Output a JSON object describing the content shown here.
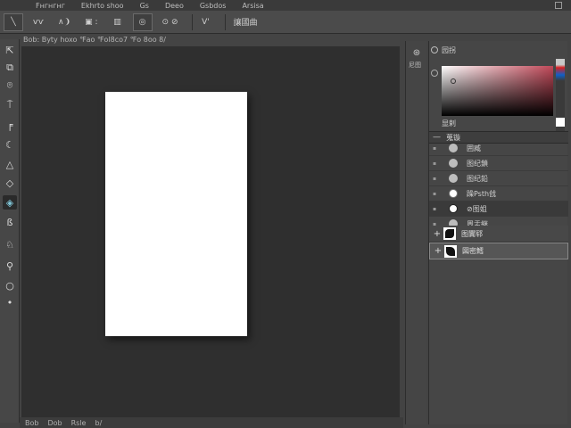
{
  "menubar": {
    "items": [
      "Fнгнгнг",
      "Ekhrto shoo",
      "Gs",
      "Deeo",
      "Gsbdos",
      "Arsisa"
    ]
  },
  "options_bar": {
    "items": [
      {
        "id": "brush-preset",
        "label": "╲"
      },
      {
        "id": "brush-size",
        "label": "ѵѵ"
      },
      {
        "id": "mode",
        "label": "∧❩"
      },
      {
        "id": "opacity",
        "label": "▣ :"
      },
      {
        "id": "flow",
        "label": "▥"
      },
      {
        "id": "airbrush",
        "label": "◎"
      },
      {
        "id": "smoothing",
        "label": "⊙ ⊘"
      },
      {
        "id": "pressure",
        "label": "V'"
      },
      {
        "id": "workspace",
        "label": "讓國曲"
      }
    ]
  },
  "doc_info": {
    "text": "Bob: Byty hoxo ℉ao ℉ol8co7 ℉o 8oo 8/"
  },
  "tools": [
    {
      "id": "move",
      "glyph": "⇱"
    },
    {
      "id": "marquee",
      "glyph": "⧉"
    },
    {
      "id": "lasso",
      "glyph": "⌾"
    },
    {
      "id": "crop",
      "glyph": "⍑"
    },
    {
      "id": "eyedropper",
      "glyph": "╒"
    },
    {
      "id": "heal",
      "glyph": "☾"
    },
    {
      "id": "brush",
      "glyph": "△"
    },
    {
      "id": "eraser",
      "glyph": "◇"
    },
    {
      "id": "gradient",
      "glyph": "◈"
    },
    {
      "id": "dodge",
      "glyph": "ß"
    },
    {
      "id": "pen",
      "glyph": "♘"
    },
    {
      "id": "type",
      "glyph": "⚲"
    },
    {
      "id": "zoom",
      "glyph": "○"
    },
    {
      "id": "extra",
      "glyph": "•"
    }
  ],
  "statusbar": {
    "items": [
      "Bob",
      "Dob",
      "Rsle",
      "b/"
    ]
  },
  "dock": {
    "icon": "⊛",
    "label": "尼图"
  },
  "color_panel": {
    "title": "园拐",
    "label": "显剌",
    "hue_colors": [
      "#c8c8c8",
      "#d52020",
      "#1060c8",
      "#3a3a3a"
    ],
    "field_color": "#c04858",
    "foreground": "#ffffff"
  },
  "layers_panel": {
    "title": "蒐镟",
    "layers": [
      {
        "name": "囲臧",
        "eye": "▪"
      },
      {
        "name": "图纪鎖",
        "eye": "▪"
      },
      {
        "name": "图纪鉛",
        "eye": "▪"
      },
      {
        "name": "躁Psth戗",
        "eye": "▪"
      },
      {
        "name": "⊘图姐",
        "eye": "▪"
      },
      {
        "name": "周盂継",
        "eye": "▪"
      }
    ],
    "groups": [
      {
        "name": "图闐郓"
      },
      {
        "name": "図密鱈"
      }
    ]
  }
}
